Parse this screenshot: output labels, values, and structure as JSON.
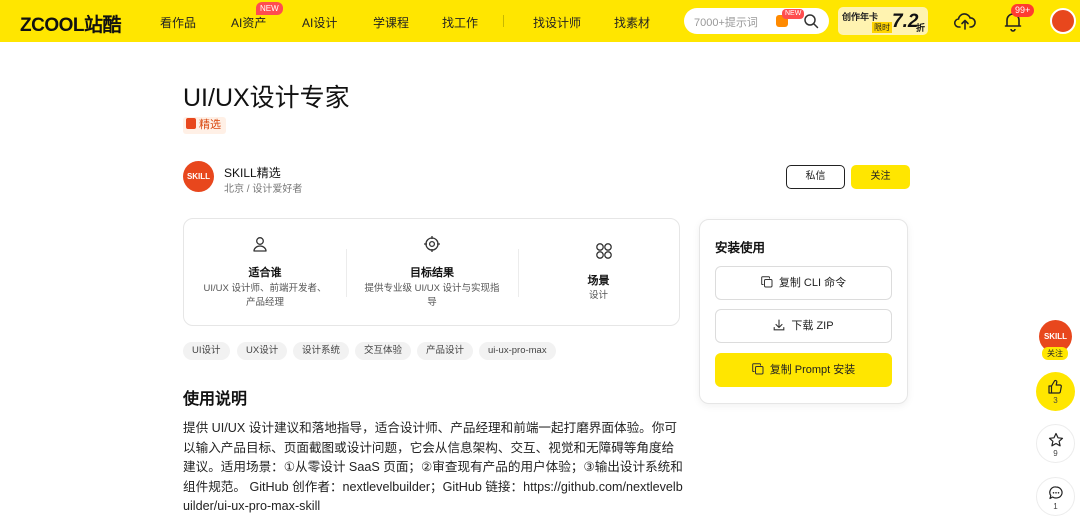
{
  "header": {
    "logo": "ZCOOL站酷",
    "nav": [
      "看作品",
      "AI资产",
      "AI设计",
      "学课程",
      "找工作",
      "找设计师",
      "找素材"
    ],
    "nav_new_badge": "NEW",
    "search_placeholder": "7000+提示词",
    "search_new_badge": "NEW",
    "promo": {
      "line1": "创作年卡",
      "line2": "限时",
      "discount": "7.2",
      "unit": "折"
    },
    "notification_count": "99+"
  },
  "page": {
    "title": "UI/UX设计专家",
    "featured_label": "精选"
  },
  "author": {
    "avatar_text": "SKILL",
    "name": "SKILL精选",
    "meta": "北京 / 设计爱好者",
    "message_button": "私信",
    "follow_button": "关注"
  },
  "info": [
    {
      "icon": "person-icon",
      "title": "适合谁",
      "desc": "UI/UX 设计师、前端开发者、产品经理"
    },
    {
      "icon": "target-icon",
      "title": "目标结果",
      "desc": "提供专业级 UI/UX 设计与实现指导"
    },
    {
      "icon": "grid-icon",
      "title": "场景",
      "desc": "设计"
    }
  ],
  "tags": [
    "UI设计",
    "UX设计",
    "设计系统",
    "交互体验",
    "产品设计",
    "ui-ux-pro-max"
  ],
  "usage": {
    "title": "使用说明",
    "body": "提供 UI/UX 设计建议和落地指导，适合设计师、产品经理和前端一起打磨界面体验。你可以输入产品目标、页面截图或设计问题，它会从信息架构、交互、视觉和无障碍等角度给建议。适用场景：①从零设计 SaaS 页面；②审查现有产品的用户体验；③输出设计系统和组件规范。 GitHub 创作者：nextlevelbuilder；GitHub 链接：https://github.com/nextlevelbuilder/ui-ux-pro-max-skill"
  },
  "install": {
    "title": "安装使用",
    "copy_cli": "复制 CLI 命令",
    "download_zip": "下载 ZIP",
    "copy_prompt": "复制 Prompt 安装"
  },
  "rail": {
    "skill_text": "SKILL",
    "follow": "关注",
    "likes": "3",
    "favorites": "9",
    "comments": "1"
  },
  "colors": {
    "brand_yellow": "#ffe600",
    "accent_orange": "#e8471d"
  }
}
